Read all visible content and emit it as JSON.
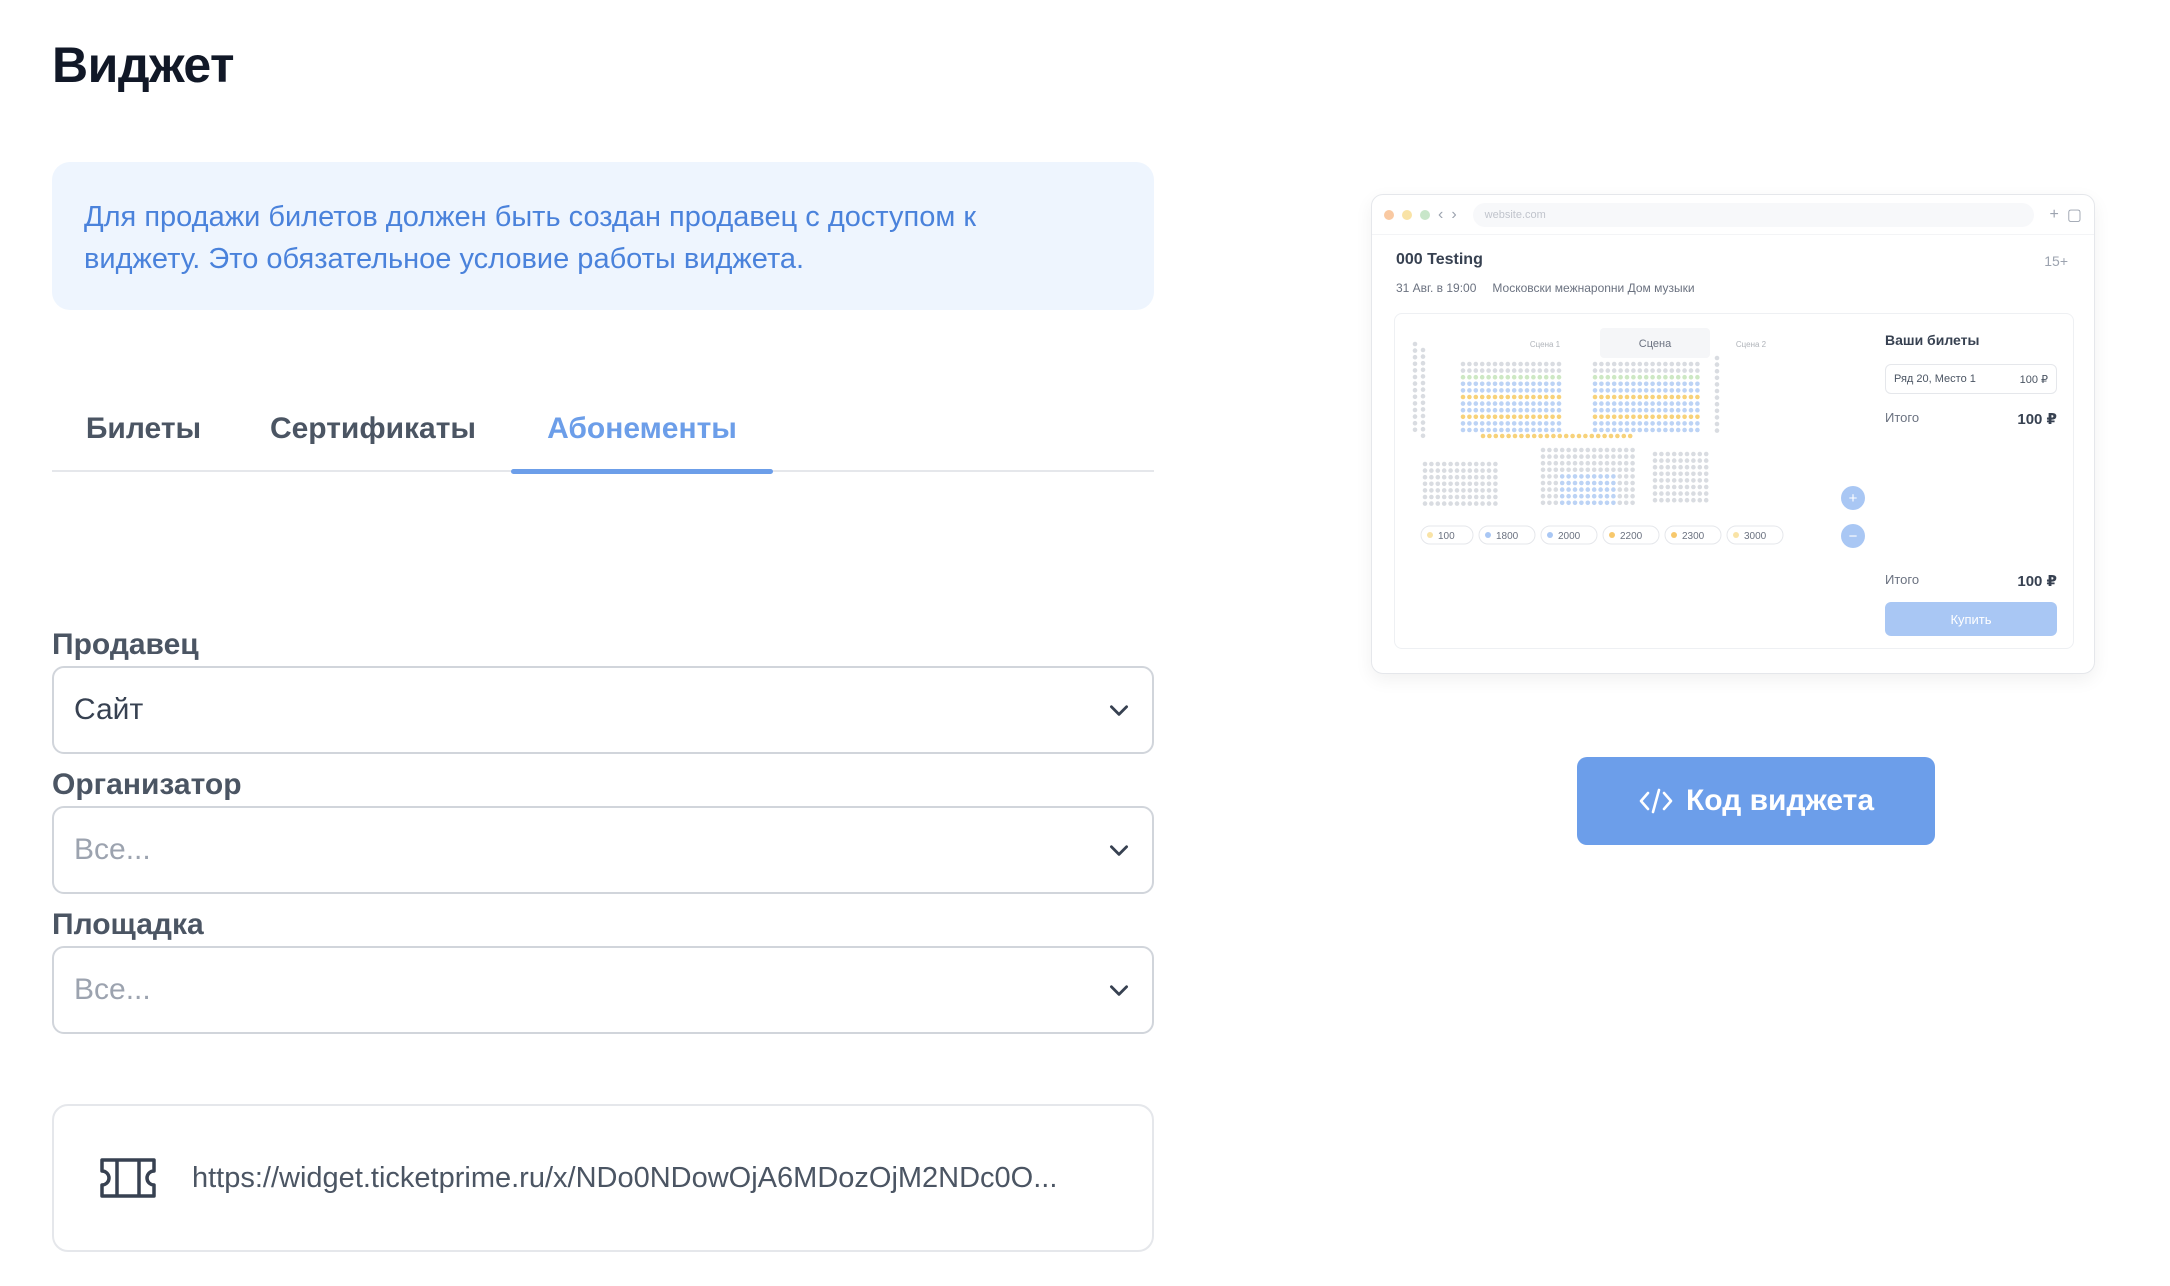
{
  "page": {
    "title": "Виджет"
  },
  "info": {
    "line1": "Для продажи билетов должен быть создан продавец с доступом к",
    "line2": "виджету. Это обязательное условие работы виджета."
  },
  "tabs": [
    {
      "label": "Билеты",
      "active": false
    },
    {
      "label": "Сертификаты",
      "active": false
    },
    {
      "label": "Абонементы",
      "active": true
    }
  ],
  "form": {
    "seller": {
      "label": "Продавец",
      "value": "Сайт"
    },
    "organizer": {
      "label": "Организатор",
      "placeholder": "Все..."
    },
    "venue": {
      "label": "Площадка",
      "placeholder": "Все..."
    }
  },
  "link": {
    "url": "https://widget.ticketprime.ru/x/NDo0NDowOjA6MDozOjM2NDc0O..."
  },
  "preview": {
    "url": "website.com",
    "event": "000 Testing",
    "age": "15+",
    "date": "31 Авг. в 19:00",
    "venue": "Московски межнароnни Дом музыки",
    "stage_label": "Сцена",
    "side_left": "Сцена 1",
    "side_right": "Сцена 2",
    "your_tickets": "Ваши билеты",
    "ticket_seat": "Ряд 20, Место 1",
    "ticket_price": "100 ₽",
    "subtotal_label": "Итого",
    "subtotal_value": "100 ₽",
    "total_label": "Итого",
    "total_value": "100 ₽",
    "buy_label": "Купить",
    "prices": [
      "100",
      "1800",
      "2000",
      "2200",
      "2300",
      "3000"
    ],
    "price_colors": [
      "#F9E3A6",
      "#A9C7F4",
      "#A9C7F4",
      "#F7C86C",
      "#F7C86C",
      "#F9E3A6"
    ]
  },
  "code_button": {
    "label": "Код виджета"
  },
  "colors": {
    "accent": "#6C9EE9",
    "info_bg": "#EEF5FE",
    "info_text": "#4A82DB"
  }
}
